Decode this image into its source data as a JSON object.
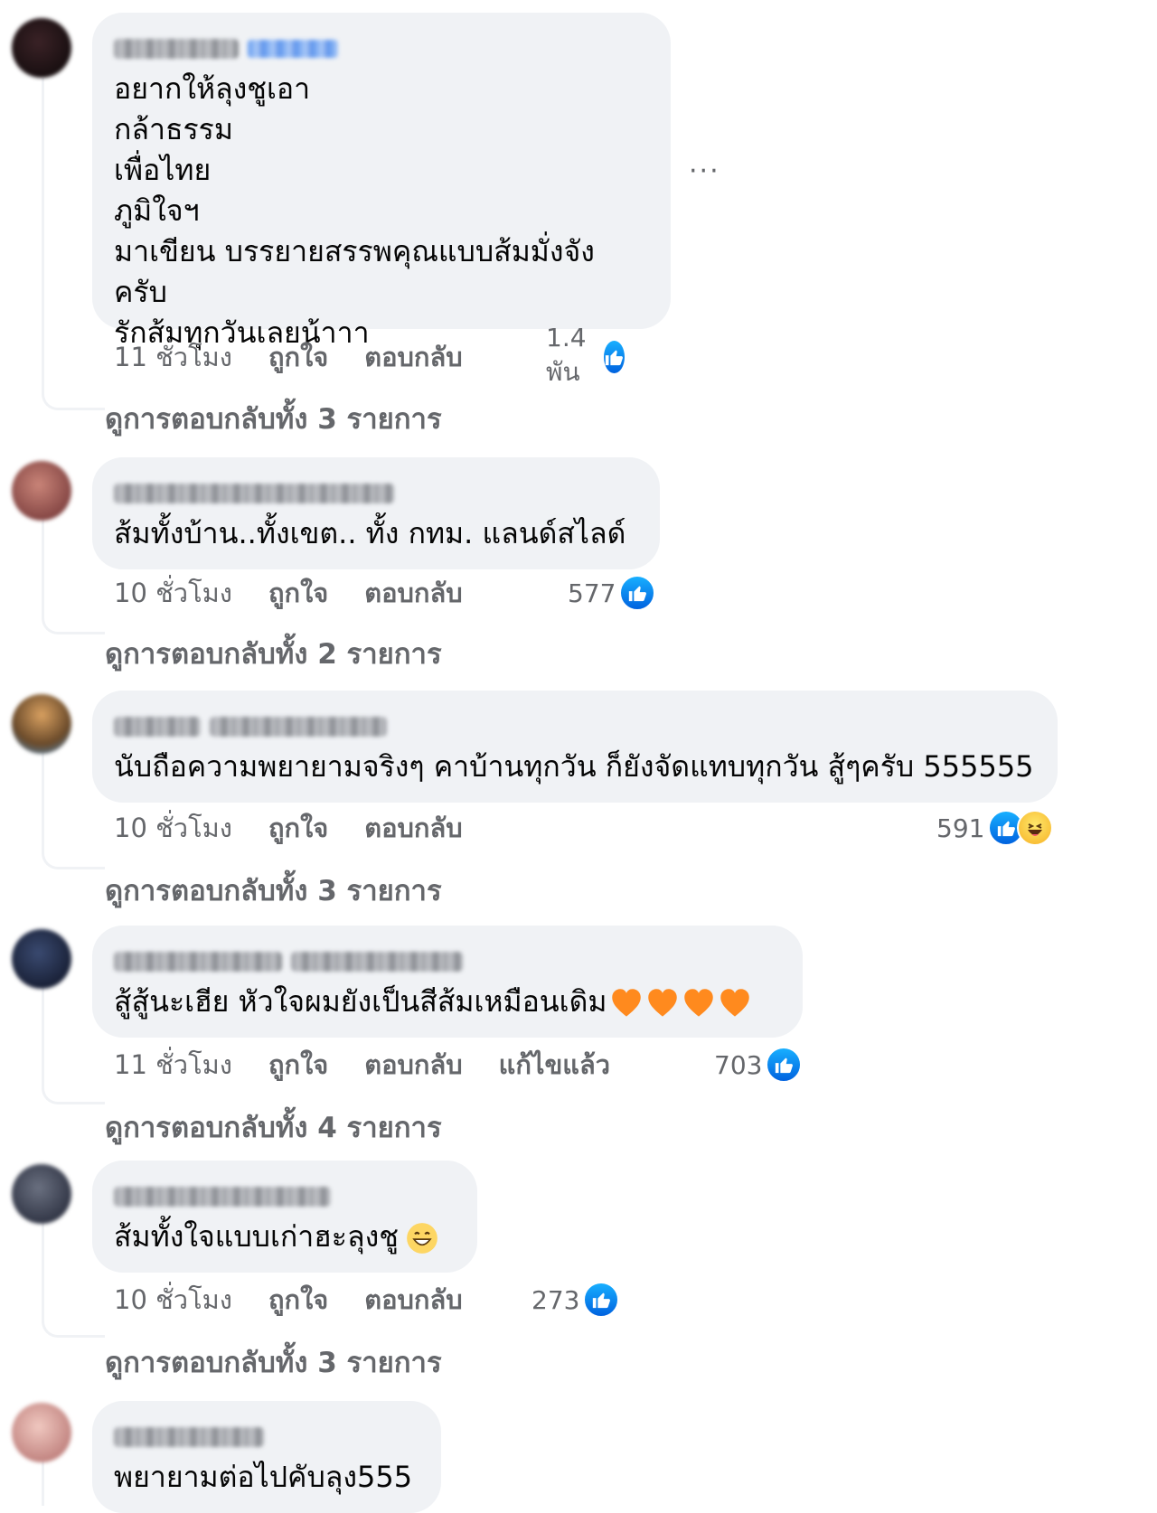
{
  "comments": [
    {
      "text": "อยากให้ลุงชูเอา\nกล้าธรรม\nเพื่อไทย\nภูมิใจฯ\nมาเขียน บรรยายสรรพคุณแบบส้มมั่งจังครับ\nรักส้มทุกวันเลยน้าาา",
      "time": "11 ชั่วโมง",
      "like_label": "ถูกใจ",
      "reply_label": "ตอบกลับ",
      "reaction_count": "1.4 พัน",
      "view_replies": "ดูการตอบกลับทั้ง 3 รายการ",
      "avatar_color": "#1c1214"
    },
    {
      "text": "ส้มทั้งบ้าน..ทั้งเขต.. ทั้ง กทม. แลนด์สไลด์",
      "time": "10 ชั่วโมง",
      "like_label": "ถูกใจ",
      "reply_label": "ตอบกลับ",
      "reaction_count": "577",
      "view_replies": "ดูการตอบกลับทั้ง 2 รายการ",
      "avatar_color": "#8a4a48"
    },
    {
      "text": "นับถือความพยายามจริงๆ คาบ้านทุกวัน ก็ยังจัดแทบทุกวัน สู้ๆครับ 555555",
      "time": "10 ชั่วโมง",
      "like_label": "ถูกใจ",
      "reply_label": "ตอบกลับ",
      "reaction_count": "591",
      "view_replies": "ดูการตอบกลับทั้ง 3 รายการ",
      "avatar_color": "#a0743c"
    },
    {
      "text": "สู้สู้นะเฮีย หัวใจผมยังเป็นสีส้มเหมือนเดิม",
      "time": "11 ชั่วโมง",
      "like_label": "ถูกใจ",
      "reply_label": "ตอบกลับ",
      "edited_label": "แก้ไขแล้ว",
      "reaction_count": "703",
      "view_replies": "ดูการตอบกลับทั้ง 4 รายการ",
      "avatar_color": "#1d2540"
    },
    {
      "text": "ส้มทั้งใจแบบเก่าฮะลุงชู",
      "time": "10 ชั่วโมง",
      "like_label": "ถูกใจ",
      "reply_label": "ตอบกลับ",
      "reaction_count": "273",
      "view_replies": "ดูการตอบกลับทั้ง 3 รายการ",
      "avatar_color": "#3c4250"
    },
    {
      "text": "พยายามต่อไปคับลุง555",
      "avatar_color": "#d89a98"
    }
  ],
  "icons": {
    "more": "more-options-icon",
    "like": "like-reaction-icon",
    "haha": "haha-reaction-icon",
    "heart": "orange-heart-emoji",
    "grin": "grinning-face-emoji"
  },
  "colors": {
    "bubble": "#f0f2f5",
    "meta_text": "#65676b",
    "like_blue": "#0866ff",
    "orange_heart": "#ff8a1e"
  }
}
